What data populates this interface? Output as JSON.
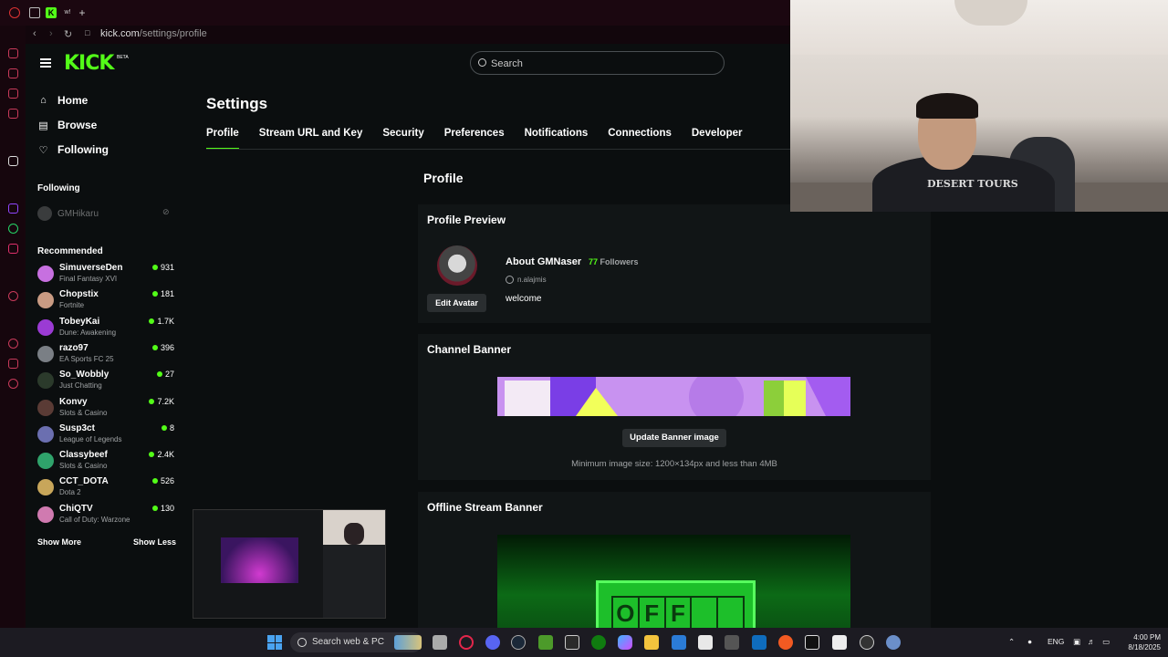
{
  "browser": {
    "url_host": "kick.com",
    "url_path": "/settings/profile"
  },
  "header": {
    "logo": "KICK",
    "logo_badge": "BETA",
    "search_placeholder": "Search"
  },
  "nav": {
    "home": "Home",
    "browse": "Browse",
    "following": "Following"
  },
  "following_section": {
    "title": "Following",
    "channel": "GMHikaru"
  },
  "recommended": {
    "title": "Recommended",
    "items": [
      {
        "name": "SimuverseDen",
        "category": "Final Fantasy XVI",
        "viewers": "931",
        "color": "#c770e0"
      },
      {
        "name": "Chopstix",
        "category": "Fortnite",
        "viewers": "181",
        "color": "#c99b83"
      },
      {
        "name": "TobeyKai",
        "category": "Dune: Awakening",
        "viewers": "1.7K",
        "color": "#9b3bd4"
      },
      {
        "name": "razo97",
        "category": "EA Sports FC 25",
        "viewers": "396",
        "color": "#7a7f85"
      },
      {
        "name": "So_Wobbly",
        "category": "Just Chatting",
        "viewers": "27",
        "color": "#2b3a2b"
      },
      {
        "name": "Konvy",
        "category": "Slots & Casino",
        "viewers": "7.2K",
        "color": "#5a3b35"
      },
      {
        "name": "Susp3ct",
        "category": "League of Legends",
        "viewers": "8",
        "color": "#6b6fb0"
      },
      {
        "name": "Classybeef",
        "category": "Slots & Casino",
        "viewers": "2.4K",
        "color": "#2fa36b"
      },
      {
        "name": "CCT_DOTA",
        "category": "Dota 2",
        "viewers": "526",
        "color": "#c8a65a"
      },
      {
        "name": "ChiQTV",
        "category": "Call of Duty: Warzone",
        "viewers": "130",
        "color": "#d07ab0"
      }
    ],
    "show_more": "Show More",
    "show_less": "Show Less"
  },
  "settings": {
    "title": "Settings",
    "tabs": [
      "Profile",
      "Stream URL and Key",
      "Security",
      "Preferences",
      "Notifications",
      "Connections",
      "Developer"
    ],
    "section_title": "Profile"
  },
  "profile_preview": {
    "title": "Profile Preview",
    "about": "About GMNaser",
    "followers_count": "77",
    "followers_label": "Followers",
    "handle": "n.alajmis",
    "bio": "welcome",
    "edit_avatar": "Edit Avatar"
  },
  "channel_banner": {
    "title": "Channel Banner",
    "button": "Update Banner image",
    "note": "Minimum image size: 1200×134px and less than 4MB"
  },
  "offline_banner": {
    "title": "Offline Stream Banner",
    "letters": [
      "O",
      "F",
      "F",
      "",
      ""
    ]
  },
  "webcam": {
    "shirt_text": "DESERT TOURS"
  },
  "taskbar": {
    "search": "Search web & PC",
    "lang": "ENG",
    "time": "4:00 PM",
    "date": "8/18/2025"
  },
  "colors": {
    "accent": "#53fc18",
    "page_bg": "#0b0e0f",
    "card_bg": "#111516"
  }
}
